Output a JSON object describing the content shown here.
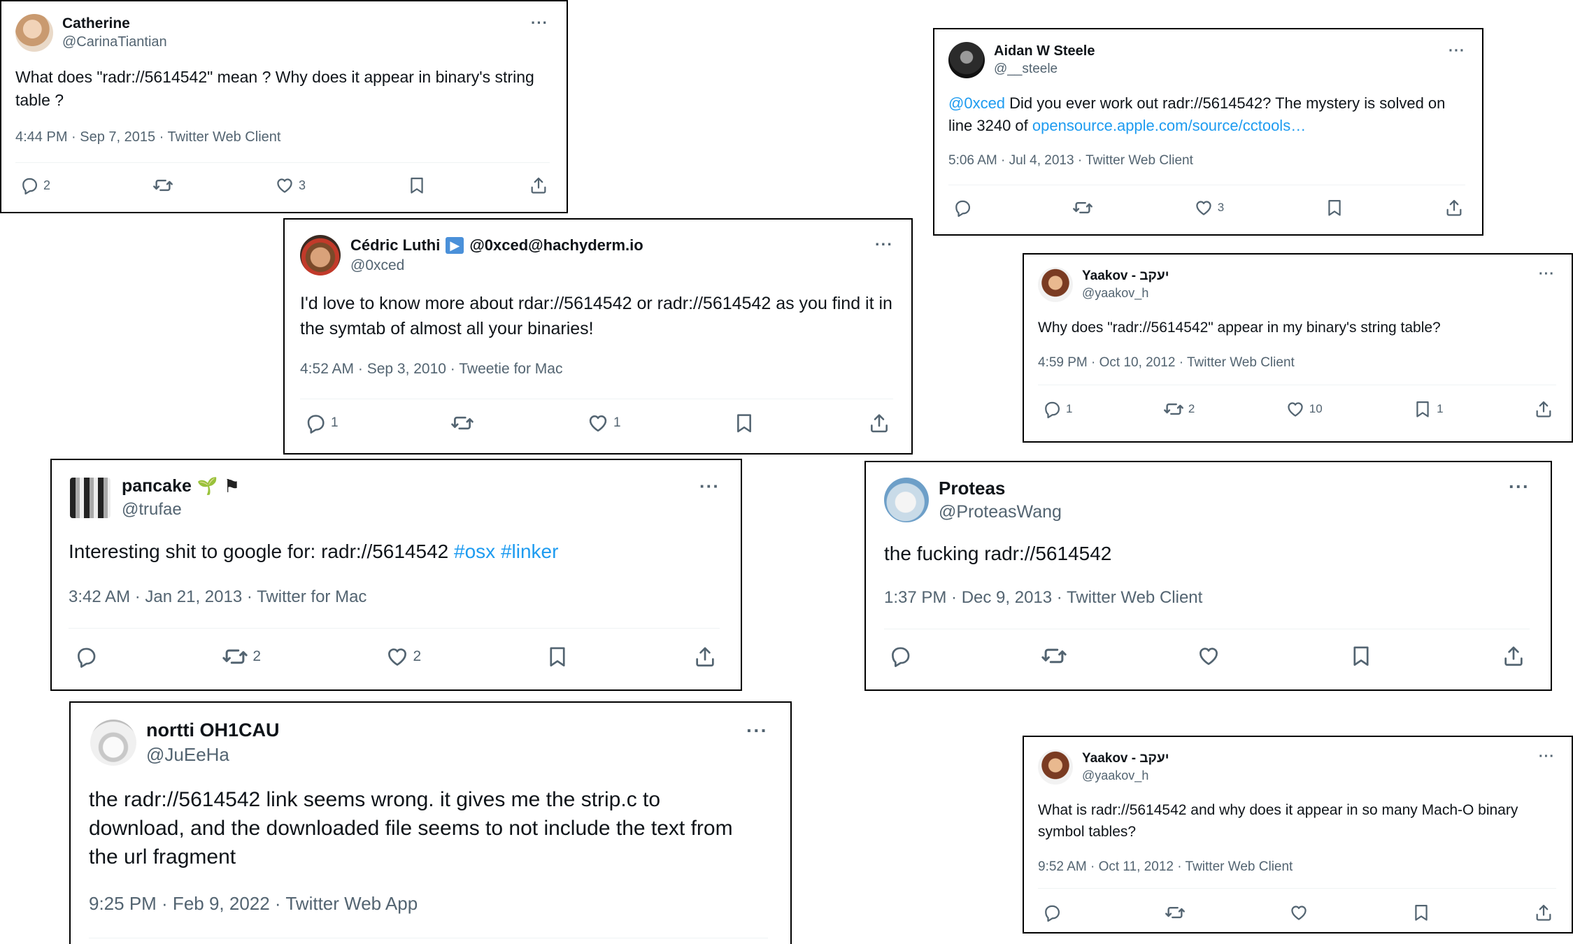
{
  "tweets": {
    "catherine": {
      "name": "Catherine",
      "handle": "@CarinaTiantian",
      "text": "What does \"radr://5614542\" mean ? Why does it appear in binary's string table ?",
      "meta": "4:44 PM · Sep 7, 2015 · Twitter Web Client",
      "counts": {
        "reply": "2",
        "retweet": "",
        "like": "3"
      }
    },
    "aidan": {
      "name": "Aidan W Steele",
      "handle": "@__steele",
      "text_mention": "@0xced",
      "text_mid": " Did you ever work out radr://5614542? The mystery is solved on line 3240 of ",
      "text_link": "opensource.apple.com/source/cctools…",
      "meta": "5:06 AM · Jul 4, 2013 · Twitter Web Client",
      "counts": {
        "reply": "",
        "retweet": "",
        "like": "3"
      }
    },
    "cedric": {
      "name": "Cédric Luthi",
      "badge": "▶",
      "name_suffix": "@0xced@hachyderm.io",
      "handle": "@0xced",
      "text": "I'd love to know more about rdar://5614542 or radr://5614542 as you find it in the symtab of almost all your binaries!",
      "meta": "4:52 AM · Sep 3, 2010 · Tweetie for Mac",
      "counts": {
        "reply": "1",
        "retweet": "",
        "like": "1"
      }
    },
    "yaakov1": {
      "name": "Yaakov - יעקב",
      "handle": "@yaakov_h",
      "text": "Why does \"radr://5614542\" appear in my binary's string table?",
      "meta": "4:59 PM · Oct 10, 2012 · Twitter Web Client",
      "counts": {
        "reply": "1",
        "retweet": "2",
        "like": "10",
        "bookmark": "1"
      }
    },
    "pancake": {
      "name": "paпcake",
      "emoji1": "🌱",
      "emoji2": "⚑",
      "handle": "@trufae",
      "text": "Interesting shit to google for: radr://5614542 ",
      "hashtags": "#osx #linker",
      "meta": "3:42 AM · Jan 21, 2013 · Twitter for Mac",
      "counts": {
        "reply": "",
        "retweet": "2",
        "like": "2"
      }
    },
    "proteas": {
      "name": "Proteas",
      "handle": "@ProteasWang",
      "text": "the fucking radr://5614542",
      "meta": "1:37 PM · Dec 9, 2013 · Twitter Web Client",
      "counts": {
        "reply": "",
        "retweet": "",
        "like": ""
      }
    },
    "nortti": {
      "name": "nortti OH1CAU",
      "handle": "@JuEeHa",
      "text": "the radr://5614542 link seems wrong. it gives me the strip.c to download, and the downloaded file seems to not include the text from the url fragment",
      "meta": "9:25 PM · Feb 9, 2022 · Twitter Web App"
    },
    "yaakov2": {
      "name": "Yaakov - יעקב",
      "handle": "@yaakov_h",
      "text": "What is radr://5614542 and why does it appear in so many Mach-O binary symbol tables?",
      "meta": "9:52 AM · Oct 11, 2012 · Twitter Web Client",
      "counts": {
        "reply": "",
        "retweet": "",
        "like": ""
      }
    }
  },
  "ui": {
    "more_glyph": "···"
  },
  "colors": {
    "link": "#1d9bf0",
    "muted": "#536471",
    "text": "#0f1419",
    "border": "#000000"
  },
  "icons": [
    "reply-icon",
    "retweet-icon",
    "like-icon",
    "bookmark-icon",
    "share-icon",
    "more-icon"
  ]
}
